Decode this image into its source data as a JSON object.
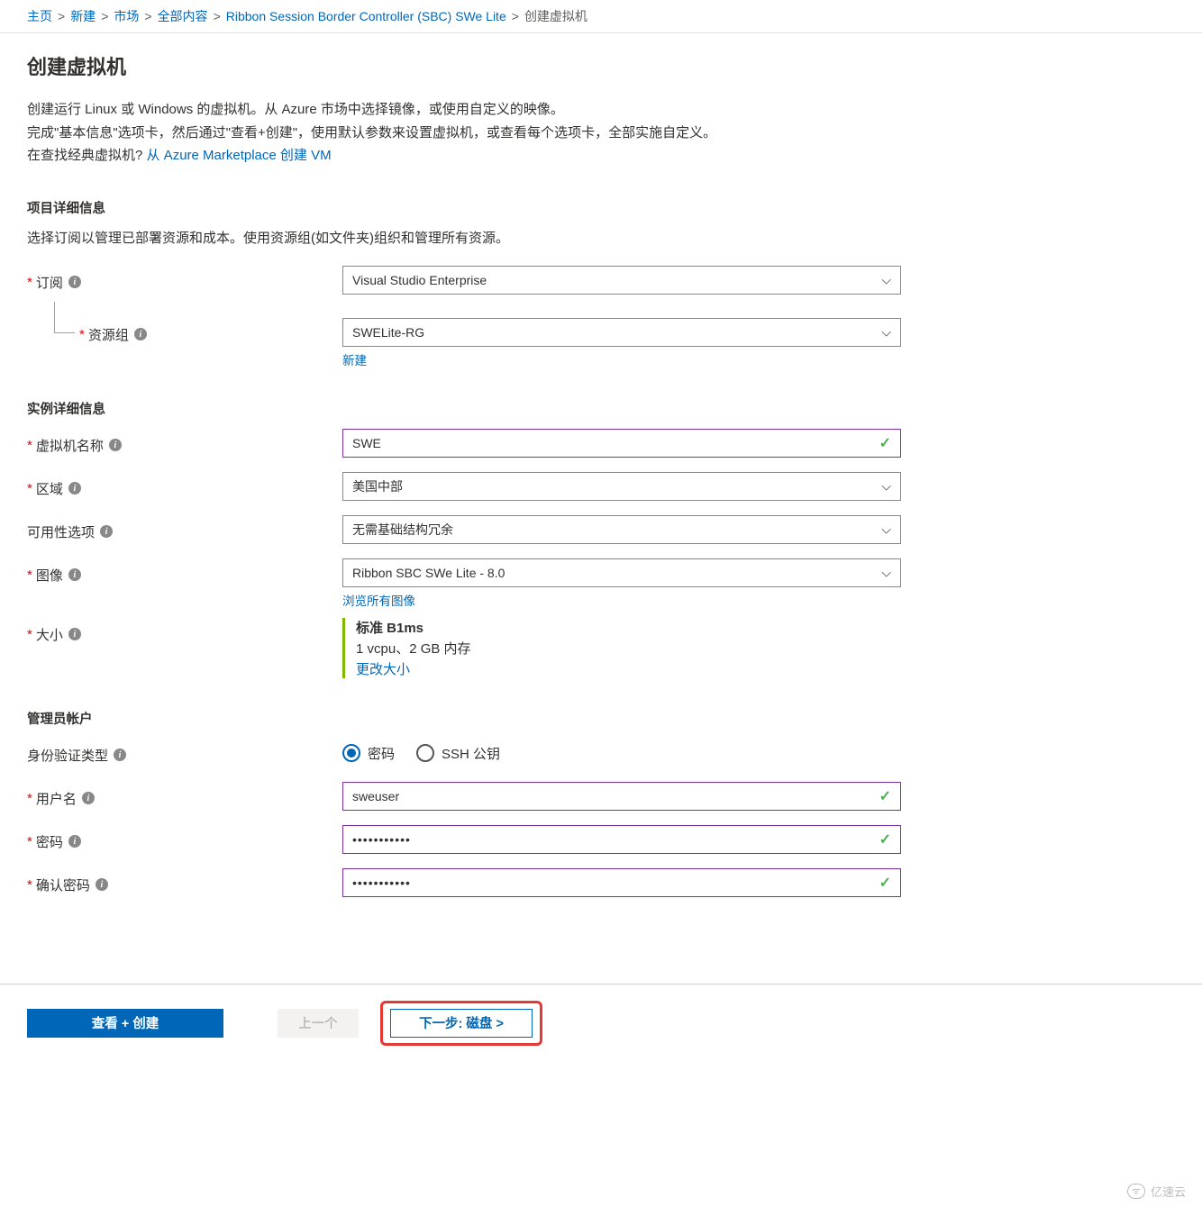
{
  "breadcrumb": {
    "items": [
      {
        "label": "主页"
      },
      {
        "label": "新建"
      },
      {
        "label": "市场"
      },
      {
        "label": "全部内容"
      },
      {
        "label": "Ribbon Session Border Controller (SBC) SWe Lite"
      }
    ],
    "current": "创建虚拟机",
    "separator": ">"
  },
  "page_title": "创建虚拟机",
  "intro": {
    "line1": "创建运行 Linux 或 Windows 的虚拟机。从 Azure 市场中选择镜像，或使用自定义的映像。",
    "line2": "完成\"基本信息\"选项卡，然后通过\"查看+创建\"，使用默认参数来设置虚拟机，或查看每个选项卡，全部实施自定义。",
    "line3_prefix": "在查找经典虚拟机?  ",
    "line3_link": "从 Azure Marketplace 创建 VM"
  },
  "sections": {
    "project": {
      "heading": "项目详细信息",
      "desc": "选择订阅以管理已部署资源和成本。使用资源组(如文件夹)组织和管理所有资源。",
      "subscription": {
        "label": "订阅",
        "value": "Visual Studio Enterprise"
      },
      "resource_group": {
        "label": "资源组",
        "value": "SWELite-RG",
        "new_link": "新建"
      }
    },
    "instance": {
      "heading": "实例详细信息",
      "vm_name": {
        "label": "虚拟机名称",
        "value": "SWE"
      },
      "region": {
        "label": "区域",
        "value": "美国中部"
      },
      "availability": {
        "label": "可用性选项",
        "value": "无需基础结构冗余"
      },
      "image": {
        "label": "图像",
        "value": "Ribbon SBC SWe Lite - 8.0",
        "browse_link": "浏览所有图像"
      },
      "size": {
        "label": "大小",
        "name": "标准 B1ms",
        "desc": "1 vcpu、2 GB 内存",
        "change_link": "更改大小"
      }
    },
    "admin": {
      "heading": "管理员帐户",
      "auth_type": {
        "label": "身份验证类型",
        "opt_password": "密码",
        "opt_ssh": "SSH 公钥",
        "selected": "password"
      },
      "username": {
        "label": "用户名",
        "value": "sweuser"
      },
      "password": {
        "label": "密码",
        "value": "•••••••••••"
      },
      "confirm": {
        "label": "确认密码",
        "value": "•••••••••••"
      }
    }
  },
  "footer": {
    "review_create": "查看 + 创建",
    "previous": "上一个",
    "next": "下一步: 磁盘 >"
  },
  "watermark": "亿速云"
}
